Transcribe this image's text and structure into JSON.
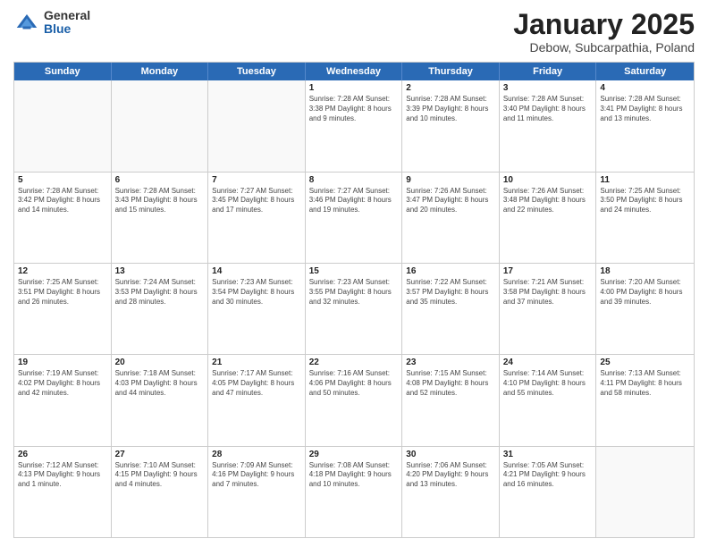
{
  "logo": {
    "general": "General",
    "blue": "Blue"
  },
  "title": "January 2025",
  "subtitle": "Debow, Subcarpathia, Poland",
  "dayHeaders": [
    "Sunday",
    "Monday",
    "Tuesday",
    "Wednesday",
    "Thursday",
    "Friday",
    "Saturday"
  ],
  "weeks": [
    [
      {
        "day": "",
        "empty": true,
        "info": ""
      },
      {
        "day": "",
        "empty": true,
        "info": ""
      },
      {
        "day": "",
        "empty": true,
        "info": ""
      },
      {
        "day": "1",
        "empty": false,
        "info": "Sunrise: 7:28 AM\nSunset: 3:38 PM\nDaylight: 8 hours\nand 9 minutes."
      },
      {
        "day": "2",
        "empty": false,
        "info": "Sunrise: 7:28 AM\nSunset: 3:39 PM\nDaylight: 8 hours\nand 10 minutes."
      },
      {
        "day": "3",
        "empty": false,
        "info": "Sunrise: 7:28 AM\nSunset: 3:40 PM\nDaylight: 8 hours\nand 11 minutes."
      },
      {
        "day": "4",
        "empty": false,
        "info": "Sunrise: 7:28 AM\nSunset: 3:41 PM\nDaylight: 8 hours\nand 13 minutes."
      }
    ],
    [
      {
        "day": "5",
        "empty": false,
        "info": "Sunrise: 7:28 AM\nSunset: 3:42 PM\nDaylight: 8 hours\nand 14 minutes."
      },
      {
        "day": "6",
        "empty": false,
        "info": "Sunrise: 7:28 AM\nSunset: 3:43 PM\nDaylight: 8 hours\nand 15 minutes."
      },
      {
        "day": "7",
        "empty": false,
        "info": "Sunrise: 7:27 AM\nSunset: 3:45 PM\nDaylight: 8 hours\nand 17 minutes."
      },
      {
        "day": "8",
        "empty": false,
        "info": "Sunrise: 7:27 AM\nSunset: 3:46 PM\nDaylight: 8 hours\nand 19 minutes."
      },
      {
        "day": "9",
        "empty": false,
        "info": "Sunrise: 7:26 AM\nSunset: 3:47 PM\nDaylight: 8 hours\nand 20 minutes."
      },
      {
        "day": "10",
        "empty": false,
        "info": "Sunrise: 7:26 AM\nSunset: 3:48 PM\nDaylight: 8 hours\nand 22 minutes."
      },
      {
        "day": "11",
        "empty": false,
        "info": "Sunrise: 7:25 AM\nSunset: 3:50 PM\nDaylight: 8 hours\nand 24 minutes."
      }
    ],
    [
      {
        "day": "12",
        "empty": false,
        "info": "Sunrise: 7:25 AM\nSunset: 3:51 PM\nDaylight: 8 hours\nand 26 minutes."
      },
      {
        "day": "13",
        "empty": false,
        "info": "Sunrise: 7:24 AM\nSunset: 3:53 PM\nDaylight: 8 hours\nand 28 minutes."
      },
      {
        "day": "14",
        "empty": false,
        "info": "Sunrise: 7:23 AM\nSunset: 3:54 PM\nDaylight: 8 hours\nand 30 minutes."
      },
      {
        "day": "15",
        "empty": false,
        "info": "Sunrise: 7:23 AM\nSunset: 3:55 PM\nDaylight: 8 hours\nand 32 minutes."
      },
      {
        "day": "16",
        "empty": false,
        "info": "Sunrise: 7:22 AM\nSunset: 3:57 PM\nDaylight: 8 hours\nand 35 minutes."
      },
      {
        "day": "17",
        "empty": false,
        "info": "Sunrise: 7:21 AM\nSunset: 3:58 PM\nDaylight: 8 hours\nand 37 minutes."
      },
      {
        "day": "18",
        "empty": false,
        "info": "Sunrise: 7:20 AM\nSunset: 4:00 PM\nDaylight: 8 hours\nand 39 minutes."
      }
    ],
    [
      {
        "day": "19",
        "empty": false,
        "info": "Sunrise: 7:19 AM\nSunset: 4:02 PM\nDaylight: 8 hours\nand 42 minutes."
      },
      {
        "day": "20",
        "empty": false,
        "info": "Sunrise: 7:18 AM\nSunset: 4:03 PM\nDaylight: 8 hours\nand 44 minutes."
      },
      {
        "day": "21",
        "empty": false,
        "info": "Sunrise: 7:17 AM\nSunset: 4:05 PM\nDaylight: 8 hours\nand 47 minutes."
      },
      {
        "day": "22",
        "empty": false,
        "info": "Sunrise: 7:16 AM\nSunset: 4:06 PM\nDaylight: 8 hours\nand 50 minutes."
      },
      {
        "day": "23",
        "empty": false,
        "info": "Sunrise: 7:15 AM\nSunset: 4:08 PM\nDaylight: 8 hours\nand 52 minutes."
      },
      {
        "day": "24",
        "empty": false,
        "info": "Sunrise: 7:14 AM\nSunset: 4:10 PM\nDaylight: 8 hours\nand 55 minutes."
      },
      {
        "day": "25",
        "empty": false,
        "info": "Sunrise: 7:13 AM\nSunset: 4:11 PM\nDaylight: 8 hours\nand 58 minutes."
      }
    ],
    [
      {
        "day": "26",
        "empty": false,
        "info": "Sunrise: 7:12 AM\nSunset: 4:13 PM\nDaylight: 9 hours\nand 1 minute."
      },
      {
        "day": "27",
        "empty": false,
        "info": "Sunrise: 7:10 AM\nSunset: 4:15 PM\nDaylight: 9 hours\nand 4 minutes."
      },
      {
        "day": "28",
        "empty": false,
        "info": "Sunrise: 7:09 AM\nSunset: 4:16 PM\nDaylight: 9 hours\nand 7 minutes."
      },
      {
        "day": "29",
        "empty": false,
        "info": "Sunrise: 7:08 AM\nSunset: 4:18 PM\nDaylight: 9 hours\nand 10 minutes."
      },
      {
        "day": "30",
        "empty": false,
        "info": "Sunrise: 7:06 AM\nSunset: 4:20 PM\nDaylight: 9 hours\nand 13 minutes."
      },
      {
        "day": "31",
        "empty": false,
        "info": "Sunrise: 7:05 AM\nSunset: 4:21 PM\nDaylight: 9 hours\nand 16 minutes."
      },
      {
        "day": "",
        "empty": true,
        "info": ""
      }
    ]
  ]
}
